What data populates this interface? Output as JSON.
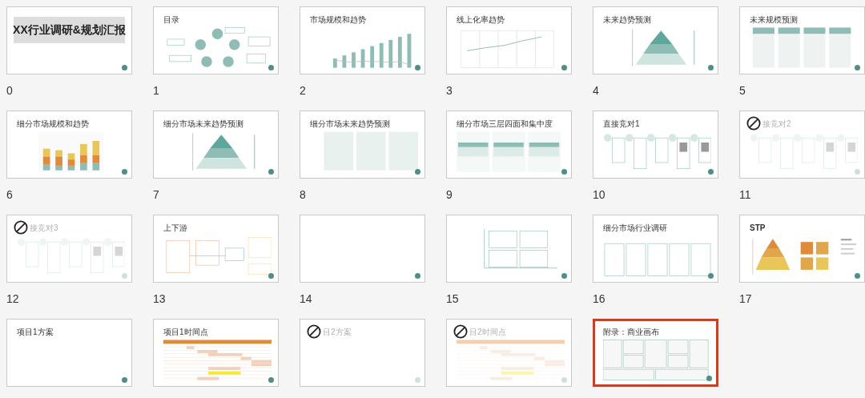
{
  "slides": [
    {
      "number": "0",
      "title": "XX行业调研&规划汇报",
      "kind": "cover",
      "skipped": false,
      "selected": false
    },
    {
      "number": "1",
      "title": "目录",
      "kind": "cycle",
      "skipped": false,
      "selected": false
    },
    {
      "number": "2",
      "title": "市场规模和趋势",
      "kind": "bars",
      "skipped": false,
      "selected": false
    },
    {
      "number": "3",
      "title": "线上化率趋势",
      "kind": "line",
      "skipped": false,
      "selected": false
    },
    {
      "number": "4",
      "title": "未来趋势预测",
      "kind": "pyramid",
      "skipped": false,
      "selected": false
    },
    {
      "number": "5",
      "title": "未来规模预测",
      "kind": "columns",
      "skipped": false,
      "selected": false
    },
    {
      "number": "6",
      "title": "细分市场规模和趋势",
      "kind": "stacked",
      "skipped": false,
      "selected": false
    },
    {
      "number": "7",
      "title": "细分市场未来趋势预测",
      "kind": "pyramid",
      "skipped": false,
      "selected": false
    },
    {
      "number": "8",
      "title": "细分市场未来趋势预测",
      "kind": "panels",
      "skipped": false,
      "selected": false
    },
    {
      "number": "9",
      "title": "细分市场三层四面和集中度",
      "kind": "tables",
      "skipped": false,
      "selected": false
    },
    {
      "number": "10",
      "title": "直接竞对1",
      "kind": "competitors",
      "skipped": false,
      "selected": false
    },
    {
      "number": "11",
      "title": "接竞对2",
      "kind": "competitors",
      "skipped": true,
      "selected": false
    },
    {
      "number": "12",
      "title": "接竞对3",
      "kind": "competitors",
      "skipped": true,
      "selected": false
    },
    {
      "number": "13",
      "title": "上下游",
      "kind": "flow",
      "skipped": false,
      "selected": false
    },
    {
      "number": "14",
      "kind": "blank",
      "skipped": false,
      "selected": false
    },
    {
      "number": "15",
      "kind": "matrix",
      "skipped": false,
      "selected": false
    },
    {
      "number": "16",
      "title": "细分市场行业调研",
      "kind": "grid",
      "skipped": false,
      "selected": false
    },
    {
      "number": "17",
      "title": "STP",
      "kind": "stp",
      "skipped": false,
      "selected": false
    },
    {
      "title": "项目1方案",
      "kind": "blank",
      "skipped": false,
      "selected": false
    },
    {
      "title": "项目1时间点",
      "kind": "gantt",
      "skipped": false,
      "selected": false
    },
    {
      "title": "目2方案",
      "kind": "blank",
      "skipped": true,
      "selected": false
    },
    {
      "title": "目2时间点",
      "kind": "gantt",
      "skipped": true,
      "selected": false
    },
    {
      "title": "附录：商业画布",
      "kind": "canvas",
      "skipped": false,
      "selected": true
    }
  ]
}
